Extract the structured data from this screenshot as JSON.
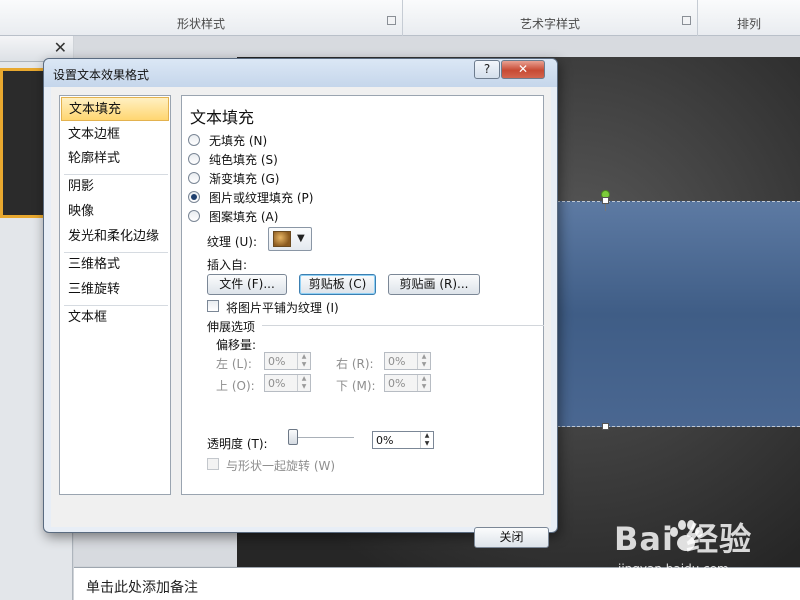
{
  "ribbon": {
    "groups": [
      {
        "label": "形状样式"
      },
      {
        "label": "艺术字样式"
      },
      {
        "label": "排列"
      }
    ]
  },
  "left_pane": {
    "close_glyph": "✕"
  },
  "icons": {
    "close": "close-icon",
    "help": "help-icon",
    "dialog_launcher": "dialog-launcher-icon",
    "dropdown": "chevron-down-icon",
    "texture": "texture-swatch-icon",
    "paw": "baidu-paw-icon"
  },
  "dialog": {
    "title": "设置文本效果格式",
    "help_glyph": "?",
    "close_glyph": "✕",
    "categories": [
      {
        "label": "文本填充",
        "selected": true
      },
      {
        "label": "文本边框"
      },
      {
        "label": "轮廓样式"
      },
      {
        "label": "阴影"
      },
      {
        "label": "映像"
      },
      {
        "label": "发光和柔化边缘"
      },
      {
        "label": "三维格式"
      },
      {
        "label": "三维旋转"
      },
      {
        "label": "文本框"
      }
    ],
    "panel": {
      "title": "文本填充",
      "fill_options": [
        {
          "label": "无填充 (N)",
          "checked": false
        },
        {
          "label": "纯色填充 (S)",
          "checked": false
        },
        {
          "label": "渐变填充 (G)",
          "checked": false
        },
        {
          "label": "图片或纹理填充 (P)",
          "checked": true
        },
        {
          "label": "图案填充 (A)",
          "checked": false
        }
      ],
      "texture_label": "纹理 (U):",
      "insert_from_label": "插入自:",
      "buttons": {
        "file": "文件 (F)...",
        "clipboard": "剪贴板 (C)",
        "clipart": "剪贴画 (R)..."
      },
      "tile_label": "将图片平铺为纹理 (I)",
      "stretch_label": "伸展选项",
      "offset_label": "偏移量:",
      "offsets": {
        "left_label": "左 (L):",
        "left_value": "0%",
        "right_label": "右 (R):",
        "right_value": "0%",
        "top_label": "上 (O):",
        "top_value": "0%",
        "bottom_label": "下 (M):",
        "bottom_value": "0%"
      },
      "transparency_label": "透明度 (T):",
      "transparency_value": "0%",
      "transparency_level": 0,
      "rotate_with_shape_label": "与形状一起旋转 (W)"
    },
    "close_button": "关闭"
  },
  "notes": {
    "placeholder": "单击此处添加备注"
  },
  "watermark": {
    "brand": "Bai 经验",
    "url": "jingyan.baidu.com"
  },
  "colors": {
    "accent_selected": "#ffd671",
    "title_close": "#c74a34",
    "banner": "#4a6791",
    "rotation_handle": "#7ccc3a"
  }
}
